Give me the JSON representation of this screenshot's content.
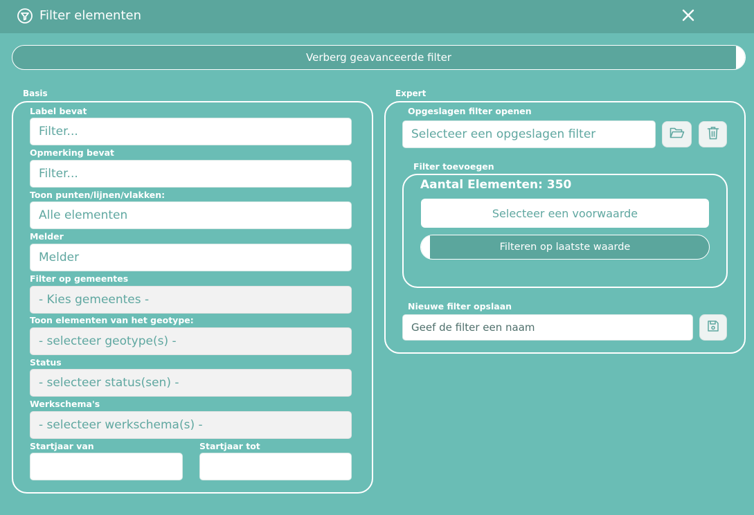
{
  "window": {
    "title": "Filter elementen",
    "title_icon": "filter-circle-icon",
    "close_icon": "close-icon"
  },
  "advanced_toggle": {
    "label": "Verberg geavanceerde filter",
    "on": true
  },
  "basis": {
    "label": "Basis",
    "fields": {
      "label_contains": {
        "label": "Label bevat",
        "placeholder": "Filter..."
      },
      "remark_contains": {
        "label": "Opmerking bevat",
        "placeholder": "Filter..."
      },
      "show_geometry": {
        "label": "Toon punten/lijnen/vlakken:",
        "value": "Alle elementen"
      },
      "reporter": {
        "label": "Melder",
        "value": "Melder"
      },
      "municipalities": {
        "label": "Filter op gemeentes",
        "value": "- Kies gemeentes -"
      },
      "geotype": {
        "label": "Toon elementen van het geotype:",
        "value": "- selecteer geotype(s) -"
      },
      "status": {
        "label": "Status",
        "value": "- selecteer status(sen) -"
      },
      "workschemes": {
        "label": "Werkschema's",
        "value": "- selecteer werkschema(s) -"
      },
      "start_year_from": {
        "label": "Startjaar van",
        "value": ""
      },
      "start_year_to": {
        "label": "Startjaar tot",
        "value": ""
      }
    }
  },
  "expert": {
    "label": "Expert",
    "open_saved": {
      "label": "Opgeslagen filter openen",
      "placeholder": "Selecteer een opgeslagen filter",
      "open_icon": "folder-open-icon",
      "delete_icon": "trash-icon"
    },
    "add_filter": {
      "label": "Filter toevoegen",
      "count_text": "Aantal Elementen: 350",
      "condition_button": "Selecteer een voorwaarde",
      "last_value_toggle": {
        "label": "Filteren op laatste waarde",
        "on": false
      }
    },
    "save_new": {
      "label": "Nieuwe filter opslaan",
      "placeholder": "Geef de filter een naam",
      "save_icon": "save-icon"
    }
  },
  "colors": {
    "background": "#6abdb5",
    "titlebar": "#5ba69d",
    "accent_text": "#5fa7a0"
  }
}
